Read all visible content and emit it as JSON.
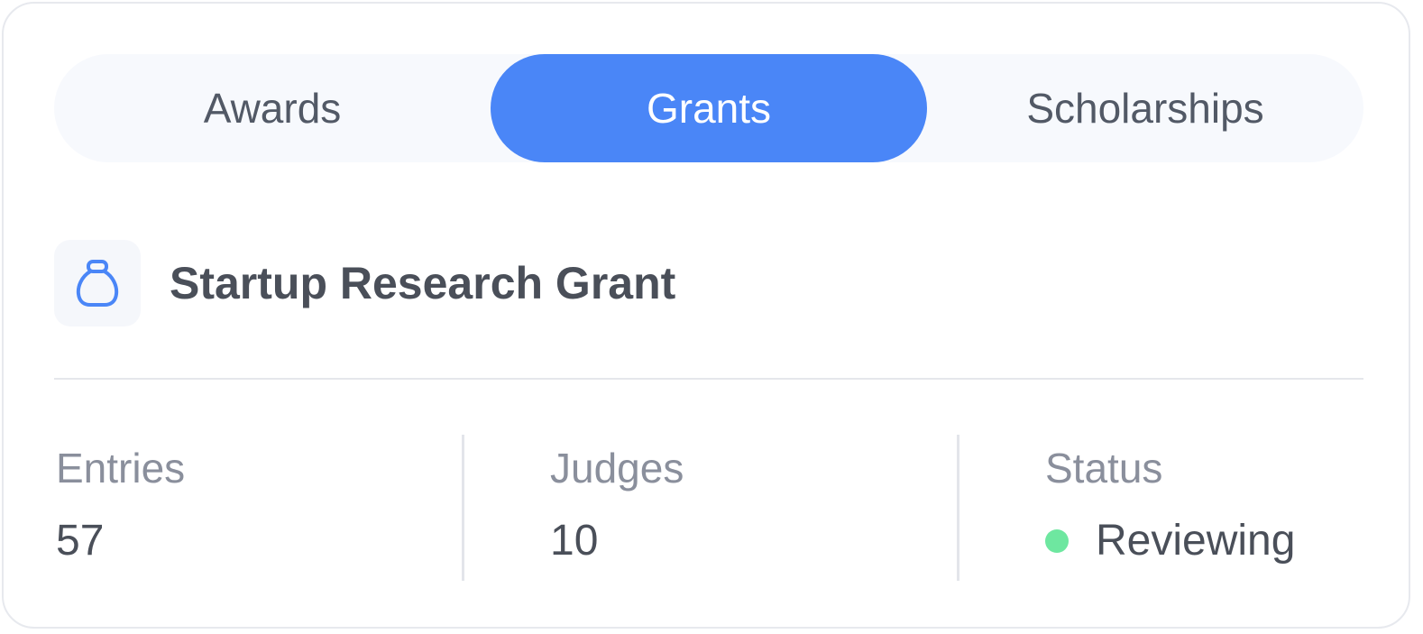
{
  "tabs": [
    {
      "label": "Awards",
      "active": false
    },
    {
      "label": "Grants",
      "active": true
    },
    {
      "label": "Scholarships",
      "active": false
    }
  ],
  "item": {
    "icon": "money-bag-icon",
    "title": "Startup Research Grant"
  },
  "stats": {
    "entries": {
      "label": "Entries",
      "value": "57"
    },
    "judges": {
      "label": "Judges",
      "value": "10"
    },
    "status": {
      "label": "Status",
      "value": "Reviewing",
      "dot_color": "#6ee7a0"
    }
  },
  "colors": {
    "accent": "#4a86f7",
    "text": "#4a4f59",
    "muted": "#8a8f9c"
  }
}
